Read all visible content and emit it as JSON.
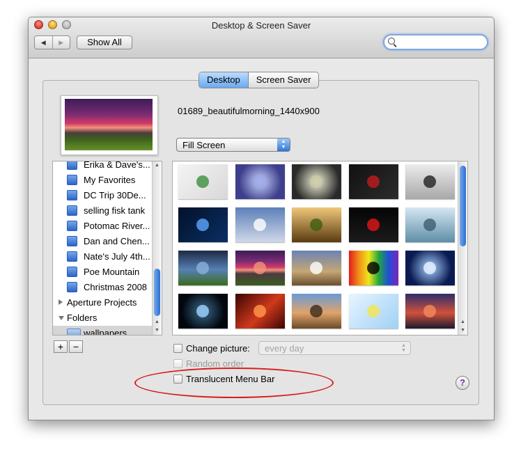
{
  "window": {
    "title": "Desktop & Screen Saver"
  },
  "toolbar": {
    "back": "◀",
    "forward": "▶",
    "show_all": "Show All",
    "search_placeholder": ""
  },
  "tabs": [
    {
      "label": "Desktop",
      "active": true
    },
    {
      "label": "Screen Saver",
      "active": false
    }
  ],
  "current": {
    "filename": "01689_beautifulmorning_1440x900",
    "fill_mode": "Fill Screen"
  },
  "sources": [
    {
      "label": "Erika & Dave's...",
      "kind": "album"
    },
    {
      "label": "My Favorites",
      "kind": "album"
    },
    {
      "label": "DC Trip 30De...",
      "kind": "album"
    },
    {
      "label": "selling fisk tank",
      "kind": "album"
    },
    {
      "label": "Potomac River...",
      "kind": "album"
    },
    {
      "label": "Dan and Chen...",
      "kind": "album"
    },
    {
      "label": "Nate's July 4th...",
      "kind": "album"
    },
    {
      "label": "Poe Mountain",
      "kind": "album"
    },
    {
      "label": "Christmas 2008",
      "kind": "album"
    },
    {
      "label": "Aperture Projects",
      "kind": "group-collapsed"
    },
    {
      "label": "Folders",
      "kind": "group-expanded"
    },
    {
      "label": "wallpapers",
      "kind": "folder-selected"
    }
  ],
  "list_controls": {
    "add": "+",
    "remove": "−"
  },
  "thumbnails": [
    {
      "name": "molecule",
      "bg": "linear-gradient(135deg,#f4f4f4,#d8d8d8)",
      "accent": "#3c8f3c"
    },
    {
      "name": "cube-lattice",
      "bg": "radial-gradient(circle,#c9d4ff,#3e3f8c 70%)",
      "accent": "#9ea8e8"
    },
    {
      "name": "glass-cube",
      "bg": "radial-gradient(circle,#f2f2d8,#2a2a2a 75%)",
      "accent": "#c9c9a8"
    },
    {
      "name": "hearts",
      "bg": "linear-gradient(135deg,#111,#2c2c2c)",
      "accent": "#c21b1b"
    },
    {
      "name": "snowflakes",
      "bg": "linear-gradient(#ececec,#a8a8a8)",
      "accent": "#222"
    },
    {
      "name": "blue-lamp",
      "bg": "linear-gradient(135deg,#02112a,#0b2f63)",
      "accent": "#5da6ff"
    },
    {
      "name": "clouds",
      "bg": "linear-gradient(#5d7fb9,#cfd8e8)",
      "accent": "#ffffff"
    },
    {
      "name": "forest-path",
      "bg": "linear-gradient(#f0c77a,#5a3b10)",
      "accent": "#3e5e12"
    },
    {
      "name": "red-device",
      "bg": "linear-gradient(#050505,#1b1b1b)",
      "accent": "#e01818"
    },
    {
      "name": "lake-mist",
      "bg": "linear-gradient(#d5e7f4,#5f8ea7)",
      "accent": "#3a5f70"
    },
    {
      "name": "stormy-field",
      "bg": "linear-gradient(#1e2a44 0%,#5680b4 55%,#3a6b1c 100%)",
      "accent": "#8bb0dc"
    },
    {
      "name": "beautiful-morning",
      "bg": "linear-gradient(#3b1d56 0%,#7a2b73 30%,#d13b67 48%,#f2927b 56%,#4f3b40 66%,#3a5d1e 100%)",
      "accent": "#f2927b"
    },
    {
      "name": "rocky-shore",
      "bg": "linear-gradient(#6a83b4,#c6a675 60%,#6a5030)",
      "accent": "#ffffff"
    },
    {
      "name": "color-bars",
      "bg": "linear-gradient(90deg,#e31b1b,#f08f1a,#f1e51a,#23a83c,#1f4fd6,#7e25b8)",
      "accent": "#000"
    },
    {
      "name": "crystal-city",
      "bg": "radial-gradient(circle,#a9d2ff,#0a1b52 70%)",
      "accent": "#e9f3ff"
    },
    {
      "name": "neural",
      "bg": "radial-gradient(circle,#3a6a8a,#02070f 70%)",
      "accent": "#9fd3ff"
    },
    {
      "name": "red-canyon",
      "bg": "linear-gradient(135deg,#3a0505,#d0391b 55%,#3a0505)",
      "accent": "#ff9a4a"
    },
    {
      "name": "monument-road",
      "bg": "linear-gradient(#6a9ad6,#e0a36a 55%,#6b4a2a)",
      "accent": "#3b2a1a"
    },
    {
      "name": "paper-plane",
      "bg": "linear-gradient(135deg,#e8f4ff,#9fd1f5)",
      "accent": "#f4e64d"
    },
    {
      "name": "sunset-shore",
      "bg": "linear-gradient(#2b2e6a,#d2503c 55%,#1b1b2e)",
      "accent": "#f58a5a"
    }
  ],
  "change_picture": {
    "label": "Change picture:",
    "checked": false,
    "interval": "every day"
  },
  "random_order": {
    "label": "Random order",
    "enabled": false
  },
  "translucent": {
    "label": "Translucent Menu Bar",
    "checked": false
  },
  "help": "?"
}
